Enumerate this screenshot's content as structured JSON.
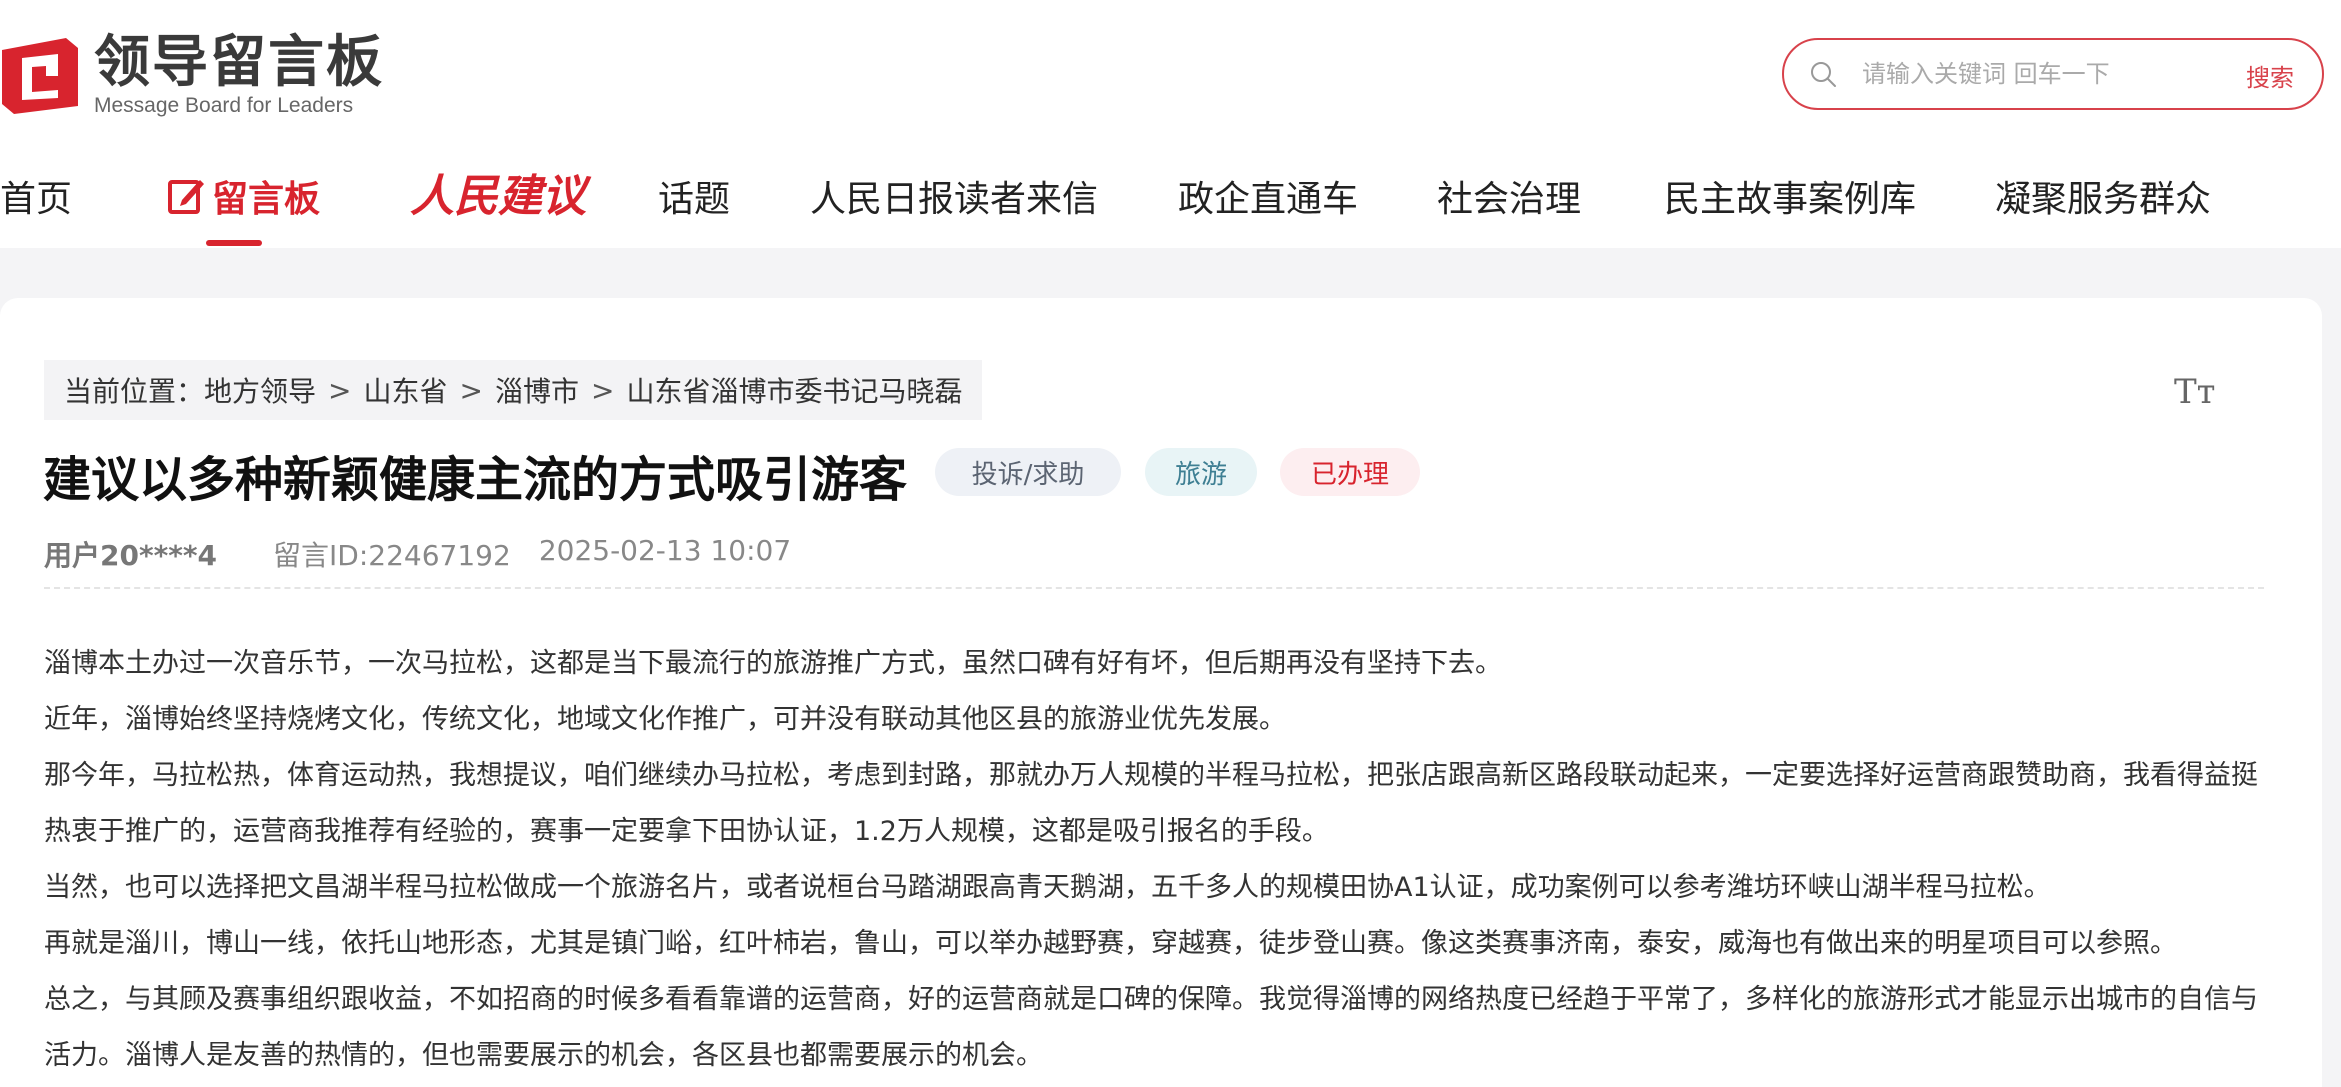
{
  "header": {
    "logo_title": "领导留言板",
    "logo_subtitle": "Message Board for Leaders",
    "search": {
      "placeholder": "请输入关键词 回车一下",
      "button_label": "搜索"
    }
  },
  "nav": {
    "items": [
      "首页",
      "留言板",
      "人民建议",
      "话题",
      "人民日报读者来信",
      "政企直通车",
      "社会治理",
      "民主故事案例库",
      "凝聚服务群众"
    ],
    "active": "留言板"
  },
  "breadcrumb": {
    "prefix": "当前位置：",
    "items": [
      "地方领导",
      "山东省",
      "淄博市",
      "山东省淄博市委书记马晓磊"
    ],
    "separator": ">"
  },
  "font_toggle": "Tт",
  "message": {
    "title": "建议以多种新颖健康主流的方式吸引游客",
    "tags": [
      "投诉/求助",
      "旅游",
      "已办理"
    ],
    "user": "用户20****4",
    "id": "留言ID:22467192",
    "time": "2025-02-13 10:07",
    "paragraphs": [
      "淄博本土办过一次音乐节，一次马拉松，这都是当下最流行的旅游推广方式，虽然口碑有好有坏，但后期再没有坚持下去。",
      "近年，淄博始终坚持烧烤文化，传统文化，地域文化作推广，可并没有联动其他区县的旅游业优先发展。",
      "那今年，马拉松热，体育运动热，我想提议，咱们继续办马拉松，考虑到封路，那就办万人规模的半程马拉松，把张店跟高新区路段联动起来，一定要选择好运营商跟赞助商，我看得益挺热衷于推广的，运营商我推荐有经验的，赛事一定要拿下田协认证，1.2万人规模，这都是吸引报名的手段。",
      "当然，也可以选择把文昌湖半程马拉松做成一个旅游名片，或者说桓台马踏湖跟高青天鹅湖，五千多人的规模田协A1认证，成功案例可以参考潍坊环峡山湖半程马拉松。",
      "再就是淄川，博山一线，依托山地形态，尤其是镇门峪，红叶柿岩，鲁山，可以举办越野赛，穿越赛，徒步登山赛。像这类赛事济南，泰安，威海也有做出来的明星项目可以参照。",
      "总之，与其顾及赛事组织跟收益，不如招商的时候多看看靠谱的运营商，好的运营商就是口碑的保障。我觉得淄博的网络热度已经趋于平常了，多样化的旅游形式才能显示出城市的自信与活力。淄博人是友善的热情的，但也需要展示的机会，各区县也都需要展示的机会。"
    ]
  },
  "colors": {
    "brand_red": "#d8242e",
    "muted_text": "#888888",
    "background_gray": "#f4f4f6"
  }
}
